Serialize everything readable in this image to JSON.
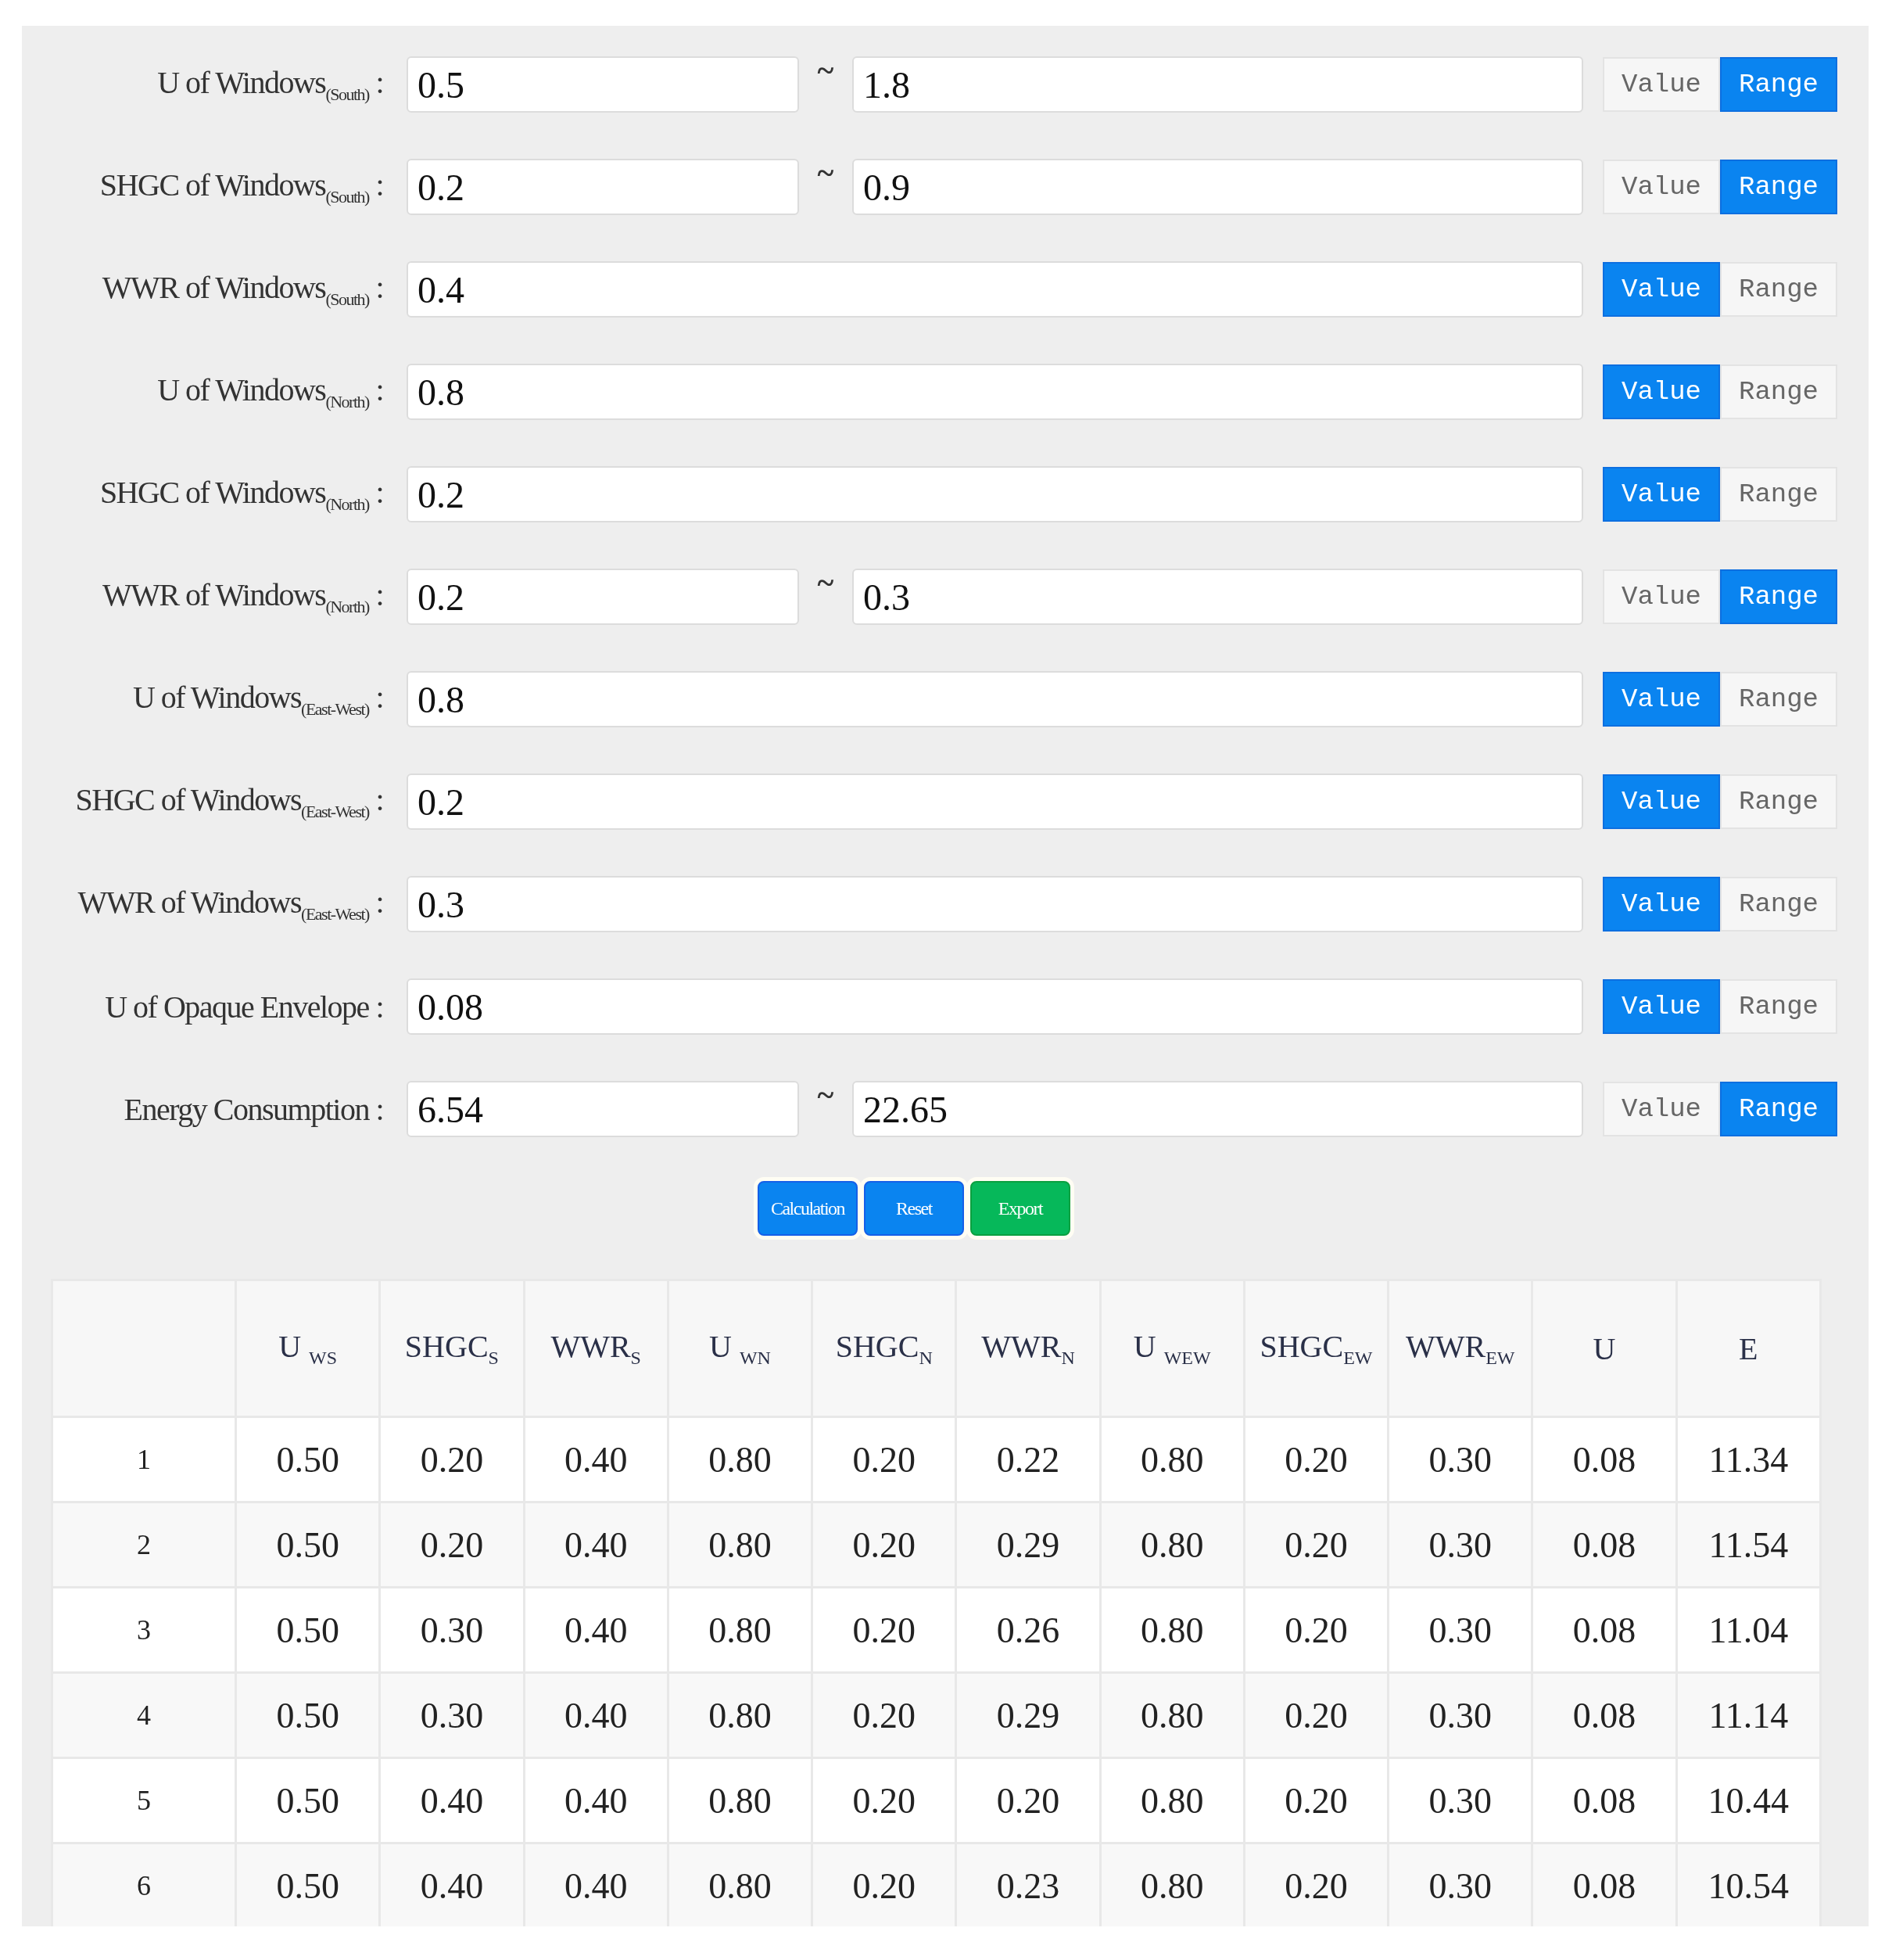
{
  "fields": [
    {
      "label": "U of Windows$_{(South)}$ :",
      "value": "0.5",
      "max_value": "1.8",
      "range_mark": "~",
      "modes": [
        {
          "label": "Value",
          "selected": false
        },
        {
          "label": "Range",
          "selected": true
        }
      ]
    },
    {
      "label": "SHGC of Windows$_{(South)}$ :",
      "value": "0.2",
      "max_value": "0.9",
      "range_mark": "~",
      "modes": [
        {
          "label": "Value",
          "selected": false
        },
        {
          "label": "Range",
          "selected": true
        }
      ]
    },
    {
      "label": "WWR of Windows$_{(South)}$ :",
      "value": "0.4",
      "modes": [
        {
          "label": "Value",
          "selected": true
        },
        {
          "label": "Range",
          "selected": false
        }
      ]
    },
    {
      "label": "U of Windows$_{(North)}$ :",
      "value": "0.8",
      "modes": [
        {
          "label": "Value",
          "selected": true
        },
        {
          "label": "Range",
          "selected": false
        }
      ]
    },
    {
      "label": "SHGC of Windows$_{(North)}$ :",
      "value": "0.2",
      "modes": [
        {
          "label": "Value",
          "selected": true
        },
        {
          "label": "Range",
          "selected": false
        }
      ]
    },
    {
      "label": "WWR of Windows$_{(North)}$ :",
      "value": "0.2",
      "max_value": "0.3",
      "range_mark": "~",
      "modes": [
        {
          "label": "Value",
          "selected": false
        },
        {
          "label": "Range",
          "selected": true
        }
      ]
    },
    {
      "label": "U of Windows$_{(East-West)}$ :",
      "value": "0.8",
      "modes": [
        {
          "label": "Value",
          "selected": true
        },
        {
          "label": "Range",
          "selected": false
        }
      ]
    },
    {
      "label": "SHGC of Windows$_{(East-West)}$ :",
      "value": "0.2",
      "modes": [
        {
          "label": "Value",
          "selected": true
        },
        {
          "label": "Range",
          "selected": false
        }
      ]
    },
    {
      "label": "WWR of Windows$_{(East-West)}$ :",
      "value": "0.3",
      "modes": [
        {
          "label": "Value",
          "selected": true
        },
        {
          "label": "Range",
          "selected": false
        }
      ]
    },
    {
      "label": "U of Opaque Envelope :",
      "value": "0.08",
      "modes": [
        {
          "label": "Value",
          "selected": true
        },
        {
          "label": "Range",
          "selected": false
        }
      ]
    },
    {
      "label": "Energy Consumption :",
      "value": "6.54",
      "max_value": "22.65",
      "range_mark": "~",
      "modes": [
        {
          "label": "Value",
          "selected": false
        },
        {
          "label": "Range",
          "selected": true
        }
      ]
    }
  ],
  "actions": [
    {
      "label": "Calculation",
      "kind": "primary"
    },
    {
      "label": "Reset",
      "kind": "primary"
    },
    {
      "label": "Export",
      "kind": "success"
    }
  ],
  "table": {
    "columns": [
      "U $_{WS}$",
      "SHGC$_{S}$",
      "WWR$_{S}$",
      "U $_{WN}$",
      "SHGC$_{N}$",
      "WWR$_{N}$",
      "U $_{WEW}$",
      "SHGC$_{EW}$",
      "WWR$_{EW}$",
      "U",
      "E"
    ],
    "rows": [
      {
        "index": "1",
        "cells": [
          "0.50",
          "0.20",
          "0.40",
          "0.80",
          "0.20",
          "0.22",
          "0.80",
          "0.20",
          "0.30",
          "0.08",
          "11.34"
        ]
      },
      {
        "index": "2",
        "cells": [
          "0.50",
          "0.20",
          "0.40",
          "0.80",
          "0.20",
          "0.29",
          "0.80",
          "0.20",
          "0.30",
          "0.08",
          "11.54"
        ]
      },
      {
        "index": "3",
        "cells": [
          "0.50",
          "0.30",
          "0.40",
          "0.80",
          "0.20",
          "0.26",
          "0.80",
          "0.20",
          "0.30",
          "0.08",
          "11.04"
        ]
      },
      {
        "index": "4",
        "cells": [
          "0.50",
          "0.30",
          "0.40",
          "0.80",
          "0.20",
          "0.29",
          "0.80",
          "0.20",
          "0.30",
          "0.08",
          "11.14"
        ]
      },
      {
        "index": "5",
        "cells": [
          "0.50",
          "0.40",
          "0.40",
          "0.80",
          "0.20",
          "0.20",
          "0.80",
          "0.20",
          "0.30",
          "0.08",
          "10.44"
        ]
      },
      {
        "index": "6",
        "cells": [
          "0.50",
          "0.40",
          "0.40",
          "0.80",
          "0.20",
          "0.23",
          "0.80",
          "0.20",
          "0.30",
          "0.08",
          "10.54"
        ]
      }
    ]
  }
}
